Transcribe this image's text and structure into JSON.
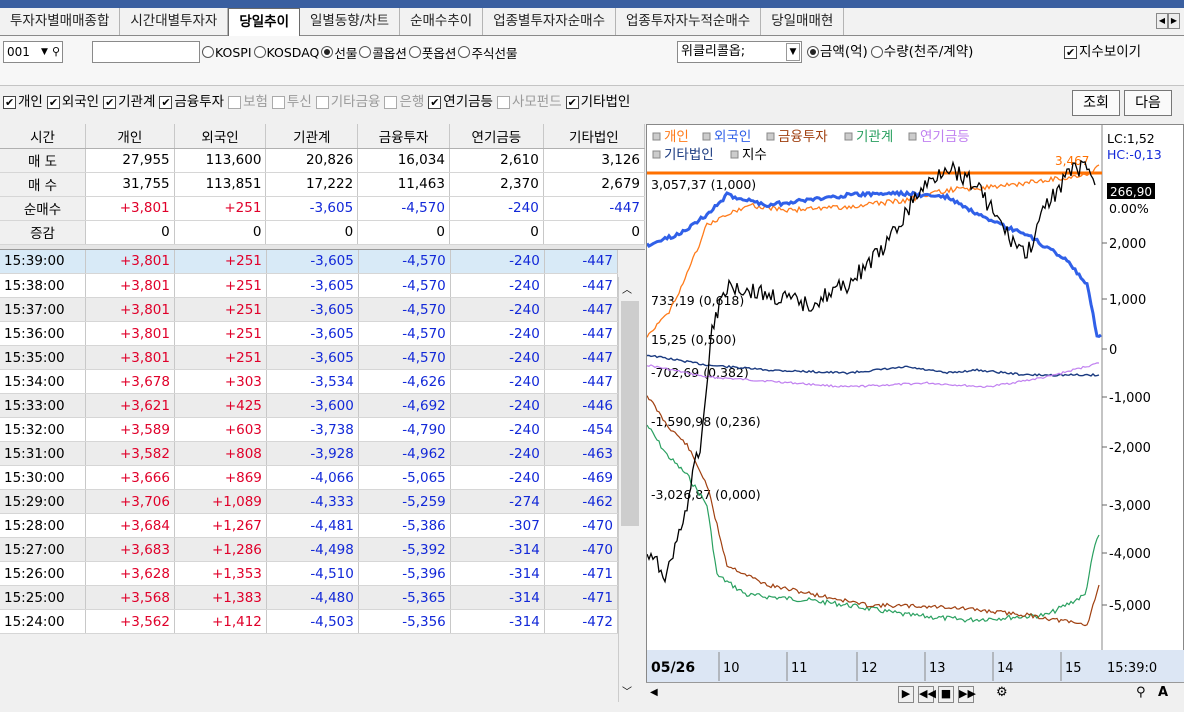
{
  "tabs": [
    "투자자별매매종합",
    "시간대별투자자",
    "당일추이",
    "일별동향/차트",
    "순매수추이",
    "업종별투자자순매수",
    "업종투자자누적순매수",
    "당일매매현"
  ],
  "active_tab": 2,
  "controls": {
    "code": "001",
    "radios": [
      "KOSPI",
      "KOSDAQ",
      "선물",
      "콜옵션",
      "풋옵션",
      "주식선물"
    ],
    "selected_radio": "선물",
    "combo": "위클리콜옵;",
    "unit_radios": [
      "금액(억)",
      "수량(천주/계약)"
    ],
    "selected_unit": "금액(억)",
    "show_index": "지수보이기",
    "lookup": "조회",
    "next": "다음"
  },
  "investor_checks": [
    {
      "label": "개인",
      "on": true
    },
    {
      "label": "외국인",
      "on": true
    },
    {
      "label": "기관계",
      "on": true
    },
    {
      "label": "금융투자",
      "on": true
    },
    {
      "label": "보험",
      "on": false
    },
    {
      "label": "투신",
      "on": false
    },
    {
      "label": "기타금융",
      "on": false
    },
    {
      "label": "은행",
      "on": false
    },
    {
      "label": "연기금등",
      "on": true
    },
    {
      "label": "사모펀드",
      "on": false
    },
    {
      "label": "기타법인",
      "on": true
    }
  ],
  "headers": [
    "시간",
    "개인",
    "외국인",
    "기관계",
    "금융투자",
    "연기금등",
    "기타법인"
  ],
  "summary": [
    [
      "매 도",
      "27,955",
      "113,600",
      "20,826",
      "16,034",
      "2,610",
      "3,126"
    ],
    [
      "매 수",
      "31,755",
      "113,851",
      "17,222",
      "11,463",
      "2,370",
      "2,679"
    ],
    [
      "순매수",
      "+3,801",
      "+251",
      "-3,605",
      "-4,570",
      "-240",
      "-447"
    ],
    [
      "증감",
      "0",
      "0",
      "0",
      "0",
      "0",
      "0"
    ]
  ],
  "rows": [
    [
      "15:39:00",
      "+3,801",
      "+251",
      "-3,605",
      "-4,570",
      "-240",
      "-447"
    ],
    [
      "15:38:00",
      "+3,801",
      "+251",
      "-3,605",
      "-4,570",
      "-240",
      "-447"
    ],
    [
      "15:37:00",
      "+3,801",
      "+251",
      "-3,605",
      "-4,570",
      "-240",
      "-447"
    ],
    [
      "15:36:00",
      "+3,801",
      "+251",
      "-3,605",
      "-4,570",
      "-240",
      "-447"
    ],
    [
      "15:35:00",
      "+3,801",
      "+251",
      "-3,605",
      "-4,570",
      "-240",
      "-447"
    ],
    [
      "15:34:00",
      "+3,678",
      "+303",
      "-3,534",
      "-4,626",
      "-240",
      "-447"
    ],
    [
      "15:33:00",
      "+3,621",
      "+425",
      "-3,600",
      "-4,692",
      "-240",
      "-446"
    ],
    [
      "15:32:00",
      "+3,589",
      "+603",
      "-3,738",
      "-4,790",
      "-240",
      "-454"
    ],
    [
      "15:31:00",
      "+3,582",
      "+808",
      "-3,928",
      "-4,962",
      "-240",
      "-463"
    ],
    [
      "15:30:00",
      "+3,666",
      "+869",
      "-4,066",
      "-5,065",
      "-240",
      "-469"
    ],
    [
      "15:29:00",
      "+3,706",
      "+1,089",
      "-4,333",
      "-5,259",
      "-274",
      "-462"
    ],
    [
      "15:28:00",
      "+3,684",
      "+1,267",
      "-4,481",
      "-5,386",
      "-307",
      "-470"
    ],
    [
      "15:27:00",
      "+3,683",
      "+1,286",
      "-4,498",
      "-5,392",
      "-314",
      "-470"
    ],
    [
      "15:26:00",
      "+3,628",
      "+1,353",
      "-4,510",
      "-5,396",
      "-314",
      "-471"
    ],
    [
      "15:25:00",
      "+3,568",
      "+1,383",
      "-4,480",
      "-5,365",
      "-314",
      "-471"
    ],
    [
      "15:24:00",
      "+3,562",
      "+1,412",
      "-4,503",
      "-5,356",
      "-314",
      "-472"
    ]
  ],
  "chart": {
    "legend": [
      {
        "name": "개인",
        "color": "#ff7b1a"
      },
      {
        "name": "외국인",
        "color": "#3060e8"
      },
      {
        "name": "금융투자",
        "color": "#a04010"
      },
      {
        "name": "기관계",
        "color": "#2aa060"
      },
      {
        "name": "연기금등",
        "color": "#c080f0"
      },
      {
        "name": "기타법인",
        "color": "#1a3a80"
      },
      {
        "name": "지수",
        "color": "#000000"
      }
    ],
    "lc": "LC:1,52",
    "hc": "HC:-0,13",
    "price": "266,90",
    "pct": "0.00%",
    "ref_value": "3,467",
    "left_labels": [
      "3,057,37 (1,000)",
      "733,19 (0,618)",
      "15,25 (0,500)",
      "-702,69 (0,382)",
      "-1,590,98 (0,236)",
      "-3,026,87 (0,000)"
    ],
    "right_ticks": [
      "2,000",
      "1,000",
      "0",
      "-1,000",
      "-2,000",
      "-3,000",
      "-4,000",
      "-5,000"
    ],
    "date": "05/26",
    "x_ticks": [
      "10",
      "11",
      "12",
      "13",
      "14",
      "15"
    ],
    "time": "15:39:0"
  }
}
